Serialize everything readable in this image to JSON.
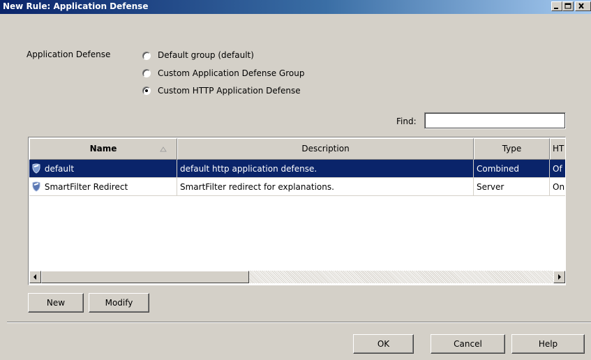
{
  "window": {
    "title": "New Rule: Application Defense"
  },
  "app_defense": {
    "label": "Application Defense",
    "options": [
      {
        "label": "Default group (default)",
        "selected": false
      },
      {
        "label": "Custom Application Defense Group",
        "selected": false
      },
      {
        "label": "Custom HTTP Application Defense",
        "selected": true
      }
    ]
  },
  "find": {
    "label": "Find:",
    "value": ""
  },
  "table": {
    "columns": [
      "Name",
      "Description",
      "Type",
      "HT"
    ],
    "rows": [
      {
        "name": "default",
        "description": "default http application defense.",
        "type": "Combined",
        "ht": "Of",
        "selected": true
      },
      {
        "name": "SmartFilter Redirect",
        "description": "SmartFilter redirect for explanations.",
        "type": "Server",
        "ht": "On",
        "selected": false
      }
    ]
  },
  "buttons": {
    "new": "New",
    "modify": "Modify",
    "ok": "OK",
    "cancel": "Cancel",
    "help": "Help"
  },
  "colors": {
    "selection": "#0a246a",
    "face": "#d4d0c8"
  }
}
